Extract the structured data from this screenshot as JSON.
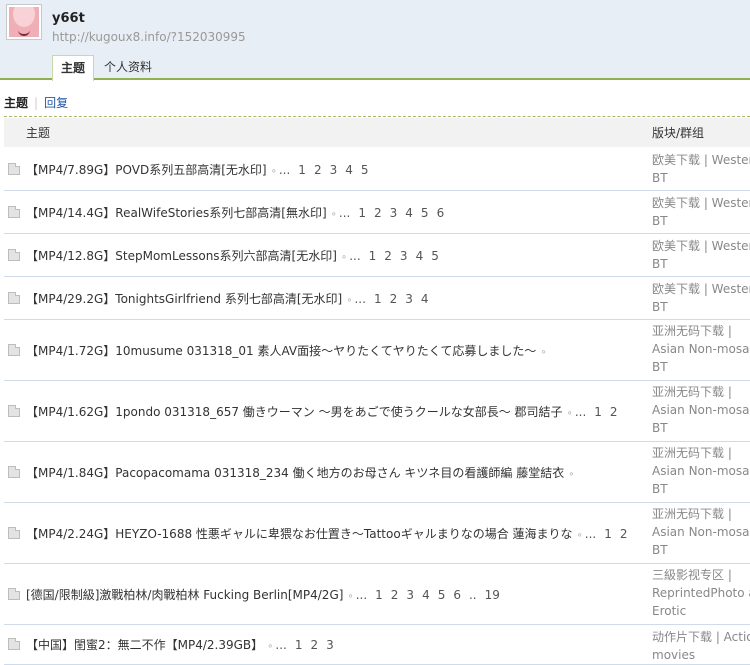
{
  "profile": {
    "username": "y66t",
    "url": "http://kugoux8.info/?152030995"
  },
  "tabs": [
    {
      "label": "主题",
      "active": true
    },
    {
      "label": "个人资料",
      "active": false
    }
  ],
  "subnav": {
    "current": "主题",
    "separator": "|",
    "reply": "回复"
  },
  "table": {
    "header_topic": "主题",
    "header_forum": "版块/群组",
    "rows": [
      {
        "title": "【MP4/7.89G】POVD系列五部高清[无水印]",
        "attach": true,
        "ellipsis": "...",
        "pages": [
          "1",
          "2",
          "3",
          "4",
          "5"
        ],
        "forum": [
          "欧美下载 | Wester",
          "BT"
        ]
      },
      {
        "title": "【MP4/14.4G】RealWifeStories系列七部高清[無水印]",
        "attach": true,
        "ellipsis": "...",
        "pages": [
          "1",
          "2",
          "3",
          "4",
          "5",
          "6"
        ],
        "forum": [
          "欧美下载 | Wester",
          "BT"
        ]
      },
      {
        "title": "【MP4/12.8G】StepMomLessons系列六部高清[无水印]",
        "attach": true,
        "ellipsis": "...",
        "pages": [
          "1",
          "2",
          "3",
          "4",
          "5"
        ],
        "forum": [
          "欧美下载 | Wester",
          "BT"
        ]
      },
      {
        "title": "【MP4/29.2G】TonightsGirlfriend 系列七部高清[无水印]",
        "attach": true,
        "ellipsis": "...",
        "pages": [
          "1",
          "2",
          "3",
          "4"
        ],
        "forum": [
          "欧美下载 | Wester",
          "BT"
        ]
      },
      {
        "title": "【MP4/1.72G】10musume 031318_01 素人AV面接～ヤりたくてヤりたくて応募しました～",
        "attach": true,
        "ellipsis": "",
        "pages": [],
        "forum": [
          "亚洲无码下载 |",
          "Asian Non-mosaic",
          "BT"
        ]
      },
      {
        "title": "【MP4/1.62G】1pondo 031318_657 働きウーマン ～男をあごで使うクールな女部長～ 郡司結子",
        "attach": true,
        "ellipsis": "...",
        "pages": [
          "1",
          "2"
        ],
        "forum": [
          "亚洲无码下载 |",
          "Asian Non-mosaic",
          "BT"
        ]
      },
      {
        "title": "【MP4/1.84G】Pacopacomama 031318_234 働く地方のお母さん キツネ目の看護師編 藤堂結衣",
        "attach": true,
        "ellipsis": "",
        "pages": [],
        "forum": [
          "亚洲无码下载 |",
          "Asian Non-mosaic",
          "BT"
        ]
      },
      {
        "title": "【MP4/2.24G】HEYZO-1688 性悪ギャルに卑猥なお仕置き～Tattooギャルまりなの場合 蓮海まりな",
        "attach": true,
        "ellipsis": "...",
        "pages": [
          "1",
          "2"
        ],
        "forum": [
          "亚洲无码下载 |",
          "Asian Non-mosaic",
          "BT"
        ]
      },
      {
        "title": "[德国/限制級]激戰柏林/肉戰柏林 Fucking Berlin[MP4/2G]",
        "attach": true,
        "ellipsis": "...",
        "pages": [
          "1",
          "2",
          "3",
          "4",
          "5",
          "6",
          "..",
          "19"
        ],
        "forum": [
          "三級影视专区 |",
          "ReprintedPhoto ar",
          "Erotic"
        ]
      },
      {
        "title": "【中国】閨蜜2：無二不作【MP4/2.39GB】",
        "attach": true,
        "ellipsis": "...",
        "pages": [
          "1",
          "2",
          "3"
        ],
        "forum": [
          "动作片下载 | Actio",
          "movies"
        ]
      }
    ]
  }
}
